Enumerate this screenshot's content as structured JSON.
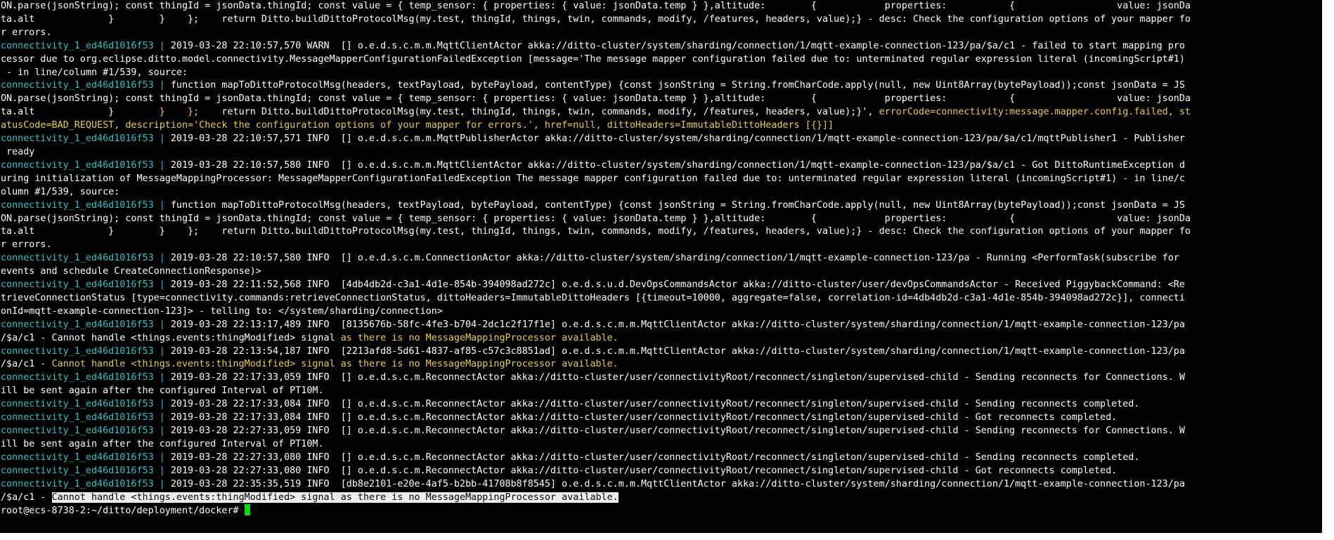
{
  "terminal": {
    "lines": [
      {
        "prefix": "",
        "text": "ON.parse(jsonString); const thingId = jsonData.thingId; const value = { temp_sensor: { properties: { value: jsonData.temp } },altitude:        {            properties:           {                  value: jsonDa"
      },
      {
        "prefix": "",
        "text": "ta.alt             }        }    };    return Ditto.buildDittoProtocolMsg(my.test, thingId, things, twin, commands, modify, /features, headers, value);} - desc: Check the configuration options of your mapper fo"
      },
      {
        "prefix": "",
        "text": "r errors."
      },
      {
        "prefix": "connectivity_1_ed46d1016f53 | ",
        "text": "2019-03-28 22:10:57,570 WARN  [] o.e.d.s.c.m.m.MqttClientActor akka://ditto-cluster/system/sharding/connection/1/mqtt-example-connection-123/pa/$a/c1 - failed to start mapping pro"
      },
      {
        "prefix": "",
        "text": "cessor due to org.eclipse.ditto.model.connectivity.MessageMapperConfigurationFailedException [message='The message mapper configuration failed due to: unterminated regular expression literal (incomingScript#1)"
      },
      {
        "prefix": "",
        "text": " - in line/column #1/539, source:"
      },
      {
        "prefix": "connectivity_1_ed46d1016f53 | ",
        "text": "function mapToDittoProtocolMsg(headers, textPayload, bytePayload, contentType) {const jsonString = String.fromCharCode.apply(null, new Uint8Array(bytePayload));const jsonData = JS"
      },
      {
        "prefix": "",
        "text": "ON.parse(jsonString); const thingId = jsonData.thingId; const value = { temp_sensor: { properties: { value: jsonData.temp } },altitude:        {            properties:           {                  value: jsonDa"
      },
      {
        "prefix": "",
        "text": "ta.alt             }        ",
        "hl": "}    };",
        "after": "    return Ditto.buildDittoProtocolMsg(my.test, thingId, things, twin, commands, modify, /features, headers, value);}', ",
        "hl2": "errorCode=connectivity:message.mapper.config.failed, st"
      },
      {
        "prefix": "",
        "text": "",
        "hl": "atusCode=BAD_REQUEST, description='Check the configuration options of your mapper for errors.', href=null, dittoHeaders=ImmutableDittoHeaders [{}]]"
      },
      {
        "prefix": "connectivity_1_ed46d1016f53 | ",
        "text": "2019-03-28 22:10:57,571 INFO  [] o.e.d.s.c.m.m.MqttPublisherActor akka://ditto-cluster/system/sharding/connection/1/mqtt-example-connection-123/pa/$a/c1/mqttPublisher1 - Publisher"
      },
      {
        "prefix": "",
        "text": " ready"
      },
      {
        "prefix": "connectivity_1_ed46d1016f53 | ",
        "text": "2019-03-28 22:10:57,580 INFO  [] o.e.d.s.c.m.m.MqttClientActor akka://ditto-cluster/system/sharding/connection/1/mqtt-example-connection-123/pa/$a/c1 - Got DittoRuntimeException d"
      },
      {
        "prefix": "",
        "text": "uring initialization of MessageMappingProcessor: MessageMapperConfigurationFailedException The message mapper configuration failed due to: unterminated regular expression literal (incomingScript#1) - in line/c"
      },
      {
        "prefix": "",
        "text": "olumn #1/539, source:"
      },
      {
        "prefix": "connectivity_1_ed46d1016f53 | ",
        "text": "function mapToDittoProtocolMsg(headers, textPayload, bytePayload, contentType) {const jsonString = String.fromCharCode.apply(null, new Uint8Array(bytePayload));const jsonData = JS"
      },
      {
        "prefix": "",
        "text": "ON.parse(jsonString); const thingId = jsonData.thingId; const value = { temp_sensor: { properties: { value: jsonData.temp } },altitude:        {            properties:           {                  value: jsonDa"
      },
      {
        "prefix": "",
        "text": "ta.alt             }        }    };    return Ditto.buildDittoProtocolMsg(my.test, thingId, things, twin, commands, modify, /features, headers, value);} - desc: Check the configuration options of your mapper fo"
      },
      {
        "prefix": "",
        "text": "r errors."
      },
      {
        "prefix": "connectivity_1_ed46d1016f53 | ",
        "text": "2019-03-28 22:10:57,580 INFO  [] o.e.d.s.c.m.ConnectionActor akka://ditto-cluster/system/sharding/connection/1/mqtt-example-connection-123/pa - Running <PerformTask(subscribe for"
      },
      {
        "prefix": "",
        "text": "events and schedule CreateConnectionResponse)>"
      },
      {
        "prefix": "connectivity_1_ed46d1016f53 | ",
        "text": "2019-03-28 22:11:52,568 INFO  [4db4db2d-c3a1-4d1e-854b-394098ad272c] o.e.d.s.u.d.DevOpsCommandsActor akka://ditto-cluster/user/devOpsCommandsActor - Received PiggybackCommand: <Re"
      },
      {
        "prefix": "",
        "text": "trieveConnectionStatus [type=connectivity.commands:retrieveConnectionStatus, dittoHeaders=ImmutableDittoHeaders [{timeout=10000, aggregate=false, correlation-id=4db4db2d-c3a1-4d1e-854b-394098ad272c}], connecti"
      },
      {
        "prefix": "",
        "text": "onId=mqtt-example-connection-123]> - telling to: </system/sharding/connection>"
      },
      {
        "prefix": "connectivity_1_ed46d1016f53 | ",
        "text": "2019-03-28 22:13:17,489 INFO  [8135676b-58fc-4fe3-b704-2dc1c2f17f1e] o.e.d.s.c.m.m.MqttClientActor akka://ditto-cluster/system/sharding/connection/1/mqtt-example-connection-123/pa"
      },
      {
        "prefix": "",
        "text": "/$a/c1 - Cannot handle <things.events:thingModified> signal ",
        "hl": "as there is no MessageMappingProcessor available."
      },
      {
        "prefix": "connectivity_1_ed46d1016f53 | ",
        "text": "2019-03-28 22:13:54,187 INFO  [2213afd8-5d61-4837-af85-c57c3c8851ad] o.e.d.s.c.m.m.MqttClientActor akka://ditto-cluster/system/sharding/connection/1/mqtt-example-connection-123/pa"
      },
      {
        "prefix": "",
        "text": "/$a/c1 - ",
        "hl": "Cannot handle <things.events:thingModified> signal as there is no MessageMappingProcessor available."
      },
      {
        "prefix": "connectivity_1_ed46d1016f53 | ",
        "text": "2019-03-28 22:17:33,059 INFO  [] o.e.d.s.c.m.ReconnectActor akka://ditto-cluster/user/connectivityRoot/reconnect/singleton/supervised-child - Sending reconnects for Connections. W"
      },
      {
        "prefix": "",
        "text": "ill be sent again after the configured Interval of PT10M."
      },
      {
        "prefix": "connectivity_1_ed46d1016f53 | ",
        "text": "2019-03-28 22:17:33,084 INFO  [] o.e.d.s.c.m.ReconnectActor akka://ditto-cluster/user/connectivityRoot/reconnect/singleton/supervised-child - Sending reconnects completed."
      },
      {
        "prefix": "connectivity_1_ed46d1016f53 | ",
        "text": "2019-03-28 22:17:33,084 INFO  [] o.e.d.s.c.m.ReconnectActor akka://ditto-cluster/user/connectivityRoot/reconnect/singleton/supervised-child - Got reconnects completed."
      },
      {
        "prefix": "connectivity_1_ed46d1016f53 | ",
        "text": "2019-03-28 22:27:33,059 INFO  [] o.e.d.s.c.m.ReconnectActor akka://ditto-cluster/user/connectivityRoot/reconnect/singleton/supervised-child - Sending reconnects for Connections. W"
      },
      {
        "prefix": "",
        "text": "ill be sent again after the configured Interval of PT10M."
      },
      {
        "prefix": "connectivity_1_ed46d1016f53 | ",
        "text": "2019-03-28 22:27:33,080 INFO  [] o.e.d.s.c.m.ReconnectActor akka://ditto-cluster/user/connectivityRoot/reconnect/singleton/supervised-child - Sending reconnects completed."
      },
      {
        "prefix": "connectivity_1_ed46d1016f53 | ",
        "text": "2019-03-28 22:27:33,080 INFO  [] o.e.d.s.c.m.ReconnectActor akka://ditto-cluster/user/connectivityRoot/reconnect/singleton/supervised-child - Got reconnects completed."
      },
      {
        "prefix": "connectivity_1_ed46d1016f53 | ",
        "text": "2019-03-28 22:35:35,519 INFO  [db8e2101-e20e-4af5-b2bb-41708b8f8545] o.e.d.s.c.m.m.MqttClientActor akka://ditto-cluster/system/sharding/connection/1/mqtt-example-connection-123/pa"
      },
      {
        "prefix": "",
        "text": "/$a/c1 - ",
        "sel": "Cannot handle <things.events:thingModified> signal as there is no MessageMappingProcessor available."
      }
    ],
    "prompt": "root@ecs-8738-2:~/ditto/deployment/docker# "
  },
  "colors": {
    "background": "#000000",
    "text": "#ffffff",
    "container_prefix": "#2ec2c2",
    "highlight": "#e6d04a",
    "selection_bg": "#ececec",
    "cursor": "#00e000"
  }
}
